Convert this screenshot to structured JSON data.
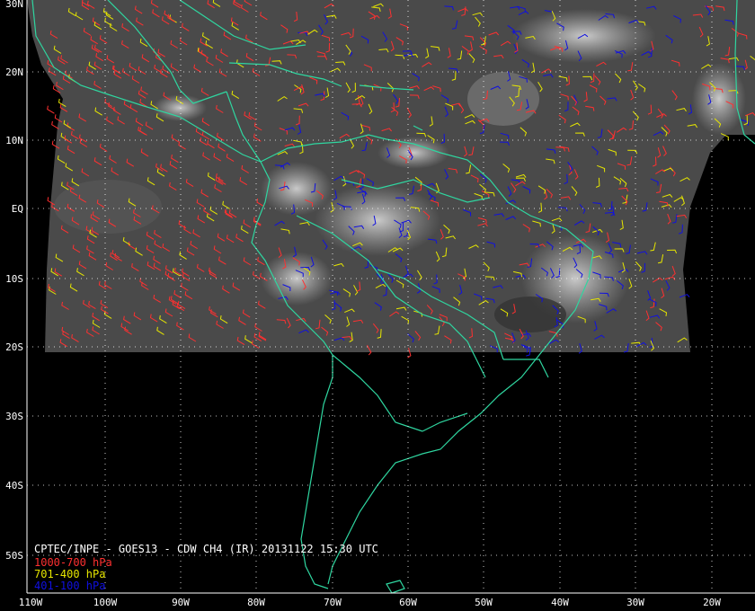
{
  "map": {
    "lon_labels": [
      "110W",
      "100W",
      "90W",
      "80W",
      "70W",
      "60W",
      "50W",
      "40W",
      "30W",
      "20W"
    ],
    "lat_labels": [
      "30N",
      "20N",
      "10N",
      "EQ",
      "10S",
      "20S",
      "30S",
      "40S",
      "50S"
    ],
    "colors": {
      "background": "#000000",
      "coastline": "#2fd6a0",
      "grid": "#ffffff",
      "low_level": "#ff3030",
      "mid_level": "#e6e600",
      "high_level": "#1010e0"
    }
  },
  "caption": {
    "title": "CPTEC/INPE - GOES13 - CDW CH4 (IR) 20131122 15:30 UTC",
    "legend": [
      {
        "label": "1000-700 hPa",
        "color": "#ff3030"
      },
      {
        "label": "701-400 hPa",
        "color": "#e6e600"
      },
      {
        "label": "401-100 hPa",
        "color": "#1010e0"
      }
    ]
  }
}
